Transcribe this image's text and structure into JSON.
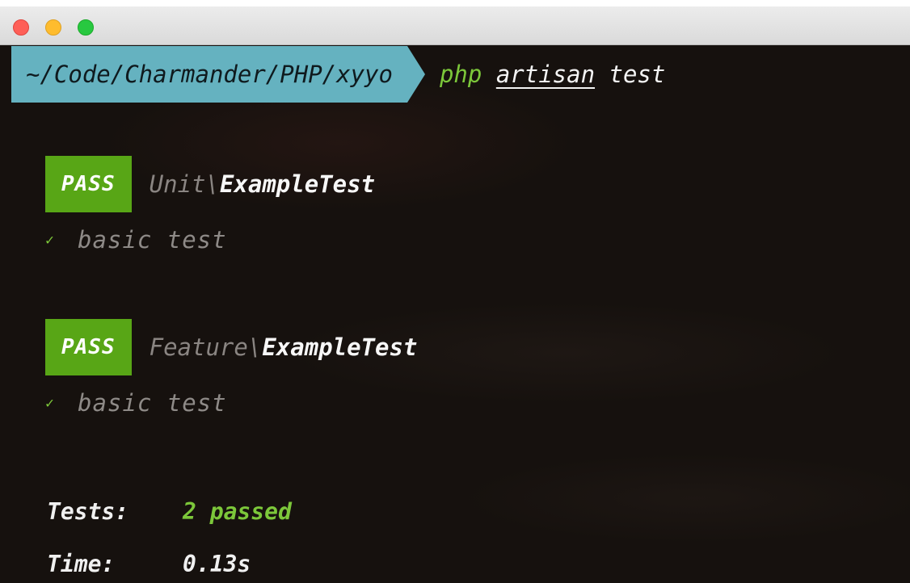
{
  "window": {
    "controls": {
      "close_color": "#fe5f57",
      "minimize_color": "#febc2e",
      "zoom_color": "#28c840"
    }
  },
  "prompt": {
    "path": "~/Code/Charmander/PHP/xyyo",
    "command": {
      "program": "php",
      "subcommand": "artisan",
      "argument": "test"
    }
  },
  "suites": [
    {
      "status": "PASS",
      "namespace": "Unit",
      "separator": "\\",
      "class_name": "ExampleTest",
      "tests": [
        {
          "icon": "check-icon",
          "symbol": "✓",
          "name": "basic test"
        }
      ]
    },
    {
      "status": "PASS",
      "namespace": "Feature",
      "separator": "\\",
      "class_name": "ExampleTest",
      "tests": [
        {
          "icon": "check-icon",
          "symbol": "✓",
          "name": "basic test"
        }
      ]
    }
  ],
  "summary": {
    "tests_label": "Tests:",
    "tests_value": "2 passed",
    "time_label": "Time:",
    "time_value": "0.13s"
  },
  "colors": {
    "background": "#16110e",
    "path_segment": "#65b2c0",
    "pass_badge": "#58a616",
    "success_text": "#7cc73a"
  }
}
